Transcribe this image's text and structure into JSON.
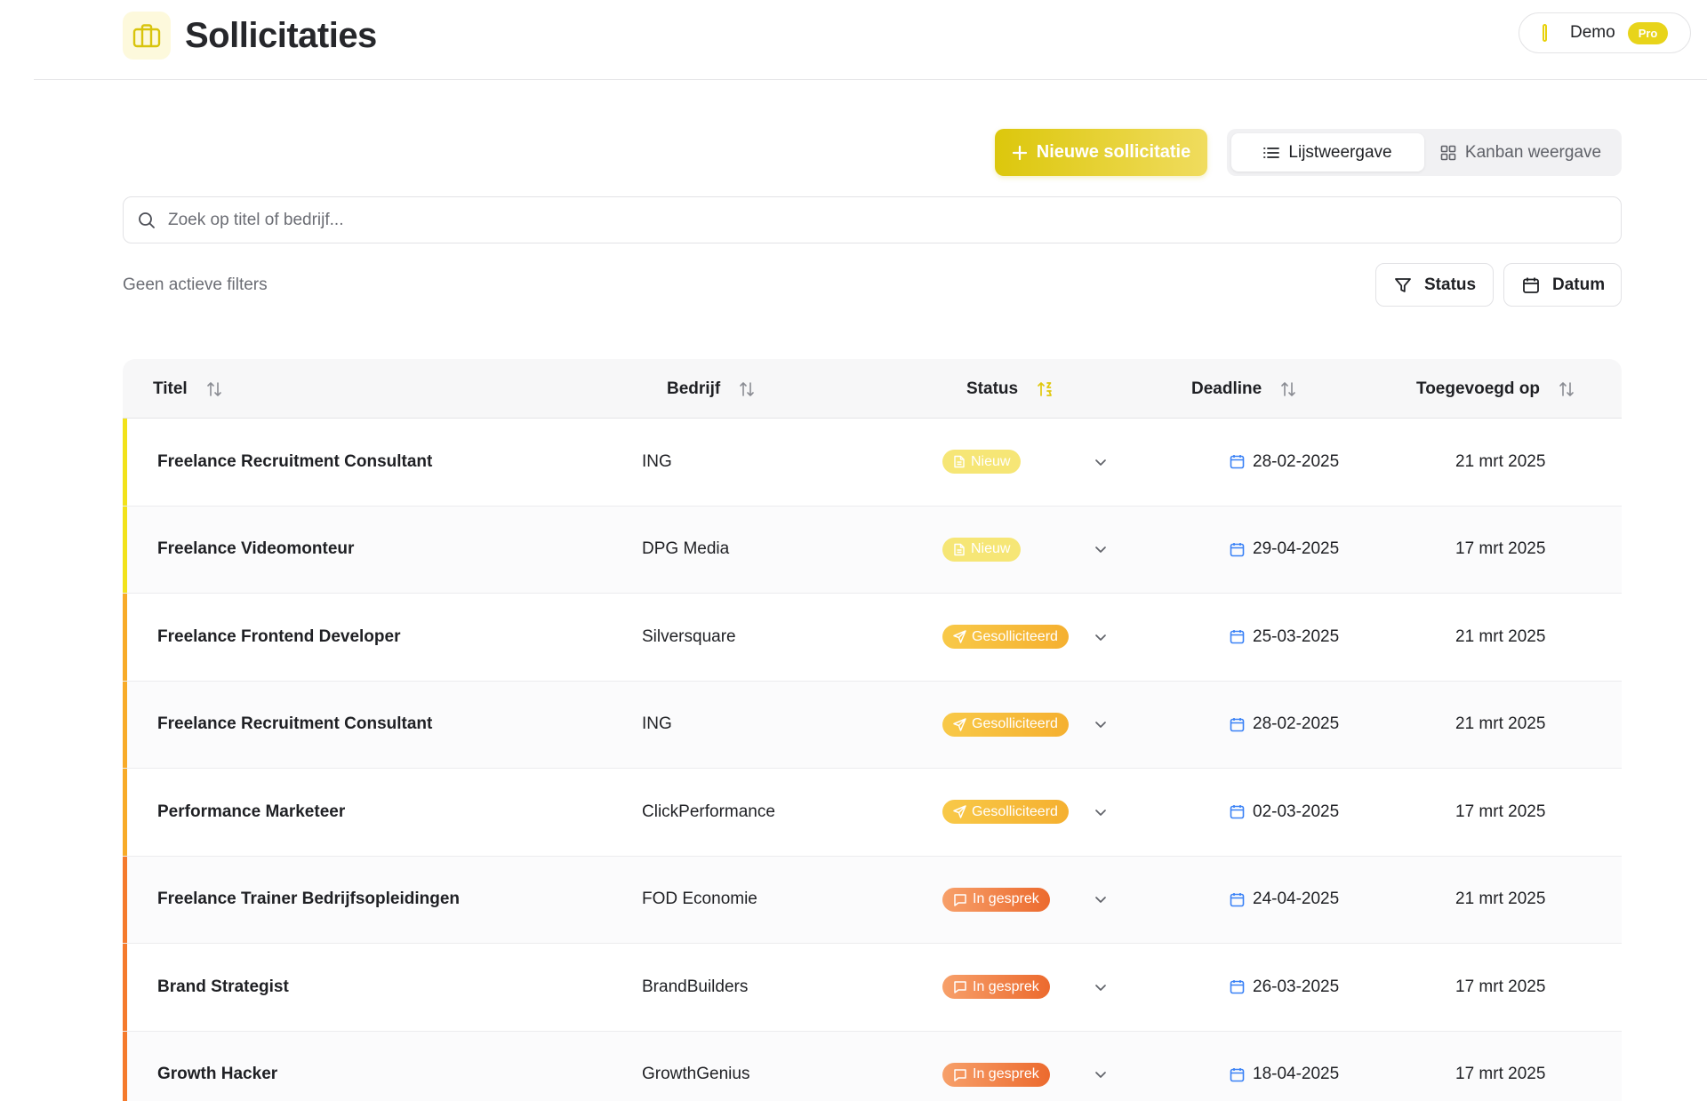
{
  "header": {
    "title": "Sollicitaties",
    "user_name": "Demo",
    "plan_badge": "Pro"
  },
  "toolbar": {
    "new_button": "Nieuwe sollicitatie",
    "view_list": "Lijstweergave",
    "view_kanban": "Kanban weergave"
  },
  "search": {
    "placeholder": "Zoek op titel of bedrijf..."
  },
  "filters": {
    "summary": "Geen actieve filters",
    "status_button": "Status",
    "date_button": "Datum"
  },
  "table": {
    "columns": [
      "Titel",
      "Bedrijf",
      "Status",
      "Deadline",
      "Toegevoegd op"
    ],
    "sorted_column": "Status",
    "rows": [
      {
        "title": "Freelance Recruitment Consultant",
        "company": "ING",
        "status": "Nieuw",
        "deadline": "28-02-2025",
        "added": "21 mrt 2025"
      },
      {
        "title": "Freelance Videomonteur",
        "company": "DPG Media",
        "status": "Nieuw",
        "deadline": "29-04-2025",
        "added": "17 mrt 2025"
      },
      {
        "title": "Freelance Frontend Developer",
        "company": "Silversquare",
        "status": "Gesolliciteerd",
        "deadline": "25-03-2025",
        "added": "21 mrt 2025"
      },
      {
        "title": "Freelance Recruitment Consultant",
        "company": "ING",
        "status": "Gesolliciteerd",
        "deadline": "28-02-2025",
        "added": "21 mrt 2025"
      },
      {
        "title": "Performance Marketeer",
        "company": "ClickPerformance",
        "status": "Gesolliciteerd",
        "deadline": "02-03-2025",
        "added": "17 mrt 2025"
      },
      {
        "title": "Freelance Trainer Bedrijfsopleidingen",
        "company": "FOD Economie",
        "status": "In gesprek",
        "deadline": "24-04-2025",
        "added": "21 mrt 2025"
      },
      {
        "title": "Brand Strategist",
        "company": "BrandBuilders",
        "status": "In gesprek",
        "deadline": "26-03-2025",
        "added": "17 mrt 2025"
      },
      {
        "title": "Growth Hacker",
        "company": "GrowthGenius",
        "status": "In gesprek",
        "deadline": "18-04-2025",
        "added": "17 mrt 2025"
      }
    ]
  },
  "colors": {
    "brand": "#e8d10a",
    "status_nieuw": "#f6e676",
    "status_gesolliciteerd": "#f5b030",
    "status_in_gesprek": "#ec6a2e",
    "accent_nieuw": "#f2e21a",
    "accent_gesolliciteerd": "#f8ab28",
    "accent_in_gesprek": "#f57a2c",
    "calendar": "#3b82f6"
  },
  "icons": {
    "logo": "briefcase-icon",
    "nieuw": "file-icon",
    "gesolliciteerd": "send-icon",
    "in_gesprek": "message-icon"
  }
}
